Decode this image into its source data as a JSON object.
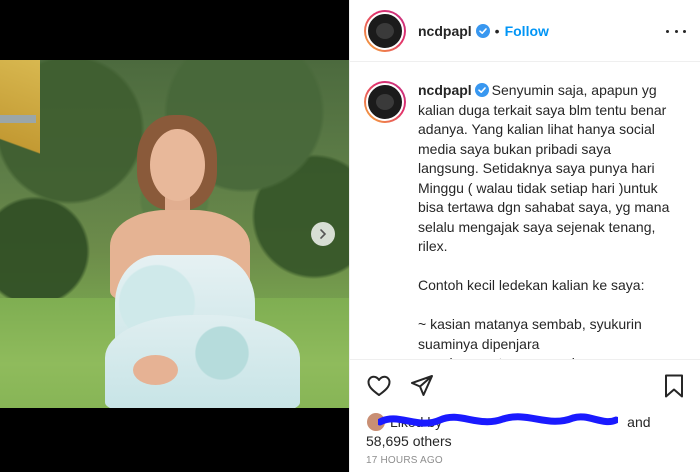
{
  "post": {
    "username": "ncdpapl",
    "follow_label": "Follow",
    "separator": "•"
  },
  "caption": {
    "username": "ncdpapl",
    "text": "Senyumin saja, apapun yg kalian duga terkait saya blm tentu benar adanya. Yang kalian lihat hanya social media saya bukan pribadi saya langsung. Setidaknya saya punya hari Minggu ( walau tidak setiap hari )untuk bisa tertawa dgn sahabat saya, yg mana selalu mengajak saya sejenak tenang, rilex.\n\nContoh kecil ledekan kalian ke saya:\n\n~ kasian matanya sembab, syukurin suaminya dipenjara\n~ malamnya tanpa suami ya"
  },
  "likes": {
    "liked_by_text": "Liked by",
    "and_text": "and",
    "others_text": "58,695 others"
  },
  "timestamp": "17 HOURS AGO",
  "icons": {
    "verified": "verified-badge-icon",
    "like": "heart-icon",
    "share": "paper-plane-icon",
    "save": "bookmark-icon",
    "next": "chevron-right-icon",
    "more": "more-options-icon"
  },
  "colors": {
    "follow_blue": "#0095f6",
    "verified_blue": "#3897f0",
    "scribble_blue": "#1a1aff",
    "muted_text": "#8e8e8e"
  }
}
